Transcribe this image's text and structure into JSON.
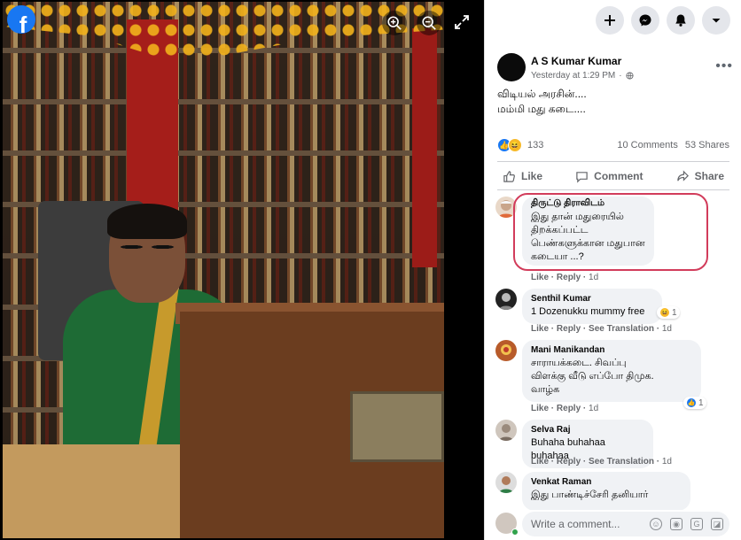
{
  "viewer": {
    "photo_alt": "Photo"
  },
  "topbar": {
    "buttons": [
      "create",
      "messenger",
      "notifications",
      "account"
    ]
  },
  "post": {
    "author": "A S Kumar Kumar",
    "timestamp": "Yesterday at 1:29 PM",
    "audience_symbol": "·",
    "text_line1": "விடியல் அரசின்....",
    "text_line2": "மம்மி மது கடை....",
    "reaction_count": "133",
    "comments": "10 Comments",
    "shares": "53 Shares"
  },
  "actions": {
    "like": "Like",
    "comment": "Comment",
    "share": "Share"
  },
  "comments": [
    {
      "name": "திருட்டு திராவிடம்",
      "text": "இது தான் மதுரையில்\nதிறக்கப்பட்ட\nபெண்களுக்கான மதுபான\nகடையா ...?",
      "like": "Like",
      "reply": "Reply",
      "time": "1d"
    },
    {
      "name": "Senthil Kumar",
      "text": "1 Dozenukku mummy free",
      "like": "Like",
      "reply": "Reply",
      "translation": "See Translation",
      "time": "1d",
      "reactions": "1"
    },
    {
      "name": "Mani Manikandan",
      "text": "சாராயக்கடை. சிவப்பு\nவிளக்கு வீடு எப்போ திமுக.\nவாழ்க",
      "like": "Like",
      "reply": "Reply",
      "time": "1d",
      "reactions": "1"
    },
    {
      "name": "Selva Raj",
      "text": "Buhaha buhahaa buhahaa",
      "like": "Like",
      "reply": "Reply",
      "translation": "See Translation",
      "time": "1d"
    },
    {
      "name": "Venkat Raman",
      "text": "இது பாண்டிச்சேரி தனியார்"
    }
  ],
  "composer": {
    "placeholder": "Write a comment..."
  },
  "colors": {
    "accent": "#1877f2",
    "highlight": "#d23c5b",
    "bubble": "#f0f2f5"
  }
}
